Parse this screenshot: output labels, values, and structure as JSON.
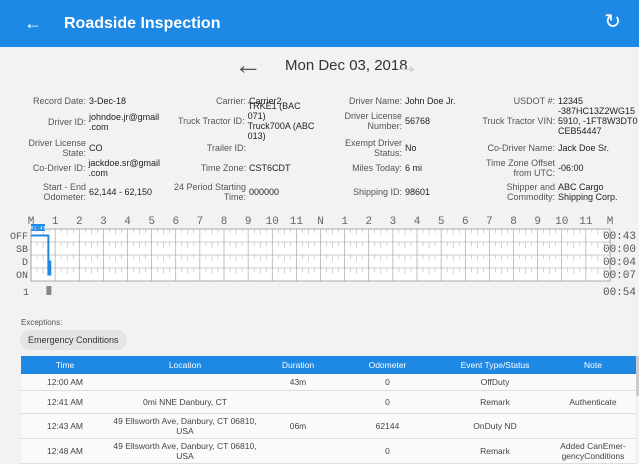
{
  "appbar": {
    "title": "Roadside Inspection"
  },
  "date_nav": {
    "date": "Mon Dec 03, 2018"
  },
  "info": {
    "record_date": {
      "label": "Record Date:",
      "value": "3-Dec-18"
    },
    "carrier": {
      "label": "Carrier:",
      "value": "Carrier2"
    },
    "driver_name": {
      "label": "Driver Name:",
      "value": "John Doe Jr."
    },
    "usdot": {
      "label": "USDOT #:",
      "value": "12345"
    },
    "driver_id": {
      "label": "Driver ID:",
      "value1": "johndoe.jr@gmail",
      "value2": ".com"
    },
    "truck_tractor_id": {
      "label": "Truck Tractor ID:",
      "value1": "TRKE1 (BAC 071)",
      "value2": "Truck700A (ABC",
      "value3": "013)"
    },
    "driver_license_number": {
      "label1": "Driver License",
      "label2": "Number:",
      "value": "56768"
    },
    "truck_tractor_vin": {
      "label": "Truck Tractor VIN:",
      "value1": "-387HC13Z2WG15",
      "value2": "5910, -1FT8W3DT0",
      "value3": "CEB54447"
    },
    "driver_license_state": {
      "label1": "Driver License",
      "label2": "State:",
      "value": "CO"
    },
    "trailer_id": {
      "label": "Trailer ID:",
      "value": ""
    },
    "exempt_driver_status": {
      "label1": "Exempt Driver",
      "label2": "Status:",
      "value": "No"
    },
    "co_driver_name": {
      "label": "Co-Driver Name:",
      "value": "Jack Doe Sr."
    },
    "co_driver_id": {
      "label": "Co-Driver ID:",
      "value1": "jackdoe.sr@gmail",
      "value2": ".com"
    },
    "time_zone": {
      "label": "Time Zone:",
      "value": "CST6CDT"
    },
    "miles_today": {
      "label": "Miles Today:",
      "value": "6 mi"
    },
    "tz_offset": {
      "label1": "Time Zone Offset",
      "label2": "from UTC:",
      "value": "-06:00"
    },
    "odometer": {
      "label1": "Start - End",
      "label2": "Odometer:",
      "value": "62,144 - 62,150"
    },
    "period_start": {
      "label1": "24 Period Starting",
      "label2": "Time:",
      "value": "000000"
    },
    "shipping_id": {
      "label": "Shipping ID:",
      "value": "98601"
    },
    "shipper": {
      "label1": "Shipper and",
      "label2": "Commodity:",
      "value1": "ABC Cargo",
      "value2": "Shipping Corp."
    }
  },
  "graph": {
    "hour_labels": [
      "M",
      "1",
      "2",
      "3",
      "4",
      "5",
      "6",
      "7",
      "8",
      "9",
      "10",
      "11",
      "N",
      "1",
      "2",
      "3",
      "4",
      "5",
      "6",
      "7",
      "8",
      "9",
      "10",
      "11",
      "M"
    ],
    "rows": [
      {
        "label": "OFF",
        "total": "00:43"
      },
      {
        "label": "SB",
        "total": "00:00"
      },
      {
        "label": "D",
        "total": "00:04"
      },
      {
        "label": "ON",
        "total": "00:07"
      }
    ],
    "grand_total": "00:54",
    "flag_text": "01:43",
    "bottom_marker": "1",
    "status_hours": {
      "off_end": 0.72,
      "on_start": 0.72,
      "d_start": 0.8
    },
    "colors": {
      "status_line": "#1e88e5",
      "grid": "#999"
    }
  },
  "exceptions": {
    "label": "Exceptions:",
    "chip": "Emergency Conditions"
  },
  "table": {
    "headers": [
      "Time",
      "Location",
      "Duration",
      "Odometer",
      "Event Type/Status",
      "Note"
    ],
    "rows": [
      {
        "time": "12:00 AM",
        "loc1": "",
        "loc2": "",
        "duration": "43m",
        "odometer": "0",
        "event": "OffDuty",
        "note1": "",
        "note2": ""
      },
      {
        "time": "12:41 AM",
        "loc1": "0mi NNE Danbury, CT",
        "loc2": "",
        "duration": "",
        "odometer": "0",
        "event": "Remark",
        "note1": "Authenticate",
        "note2": ""
      },
      {
        "time": "12:43 AM",
        "loc1": "49 Ellsworth Ave, Danbury, CT 06810,",
        "loc2": "USA",
        "duration": "06m",
        "odometer": "62144",
        "event": "OnDuty ND",
        "note1": "",
        "note2": ""
      },
      {
        "time": "12:48 AM",
        "loc1": "49 Ellsworth Ave, Danbury, CT 06810,",
        "loc2": "USA",
        "duration": "",
        "odometer": "0",
        "event": "Remark",
        "note1": "Added CanEmer-",
        "note2": "gencyConditions"
      }
    ]
  }
}
